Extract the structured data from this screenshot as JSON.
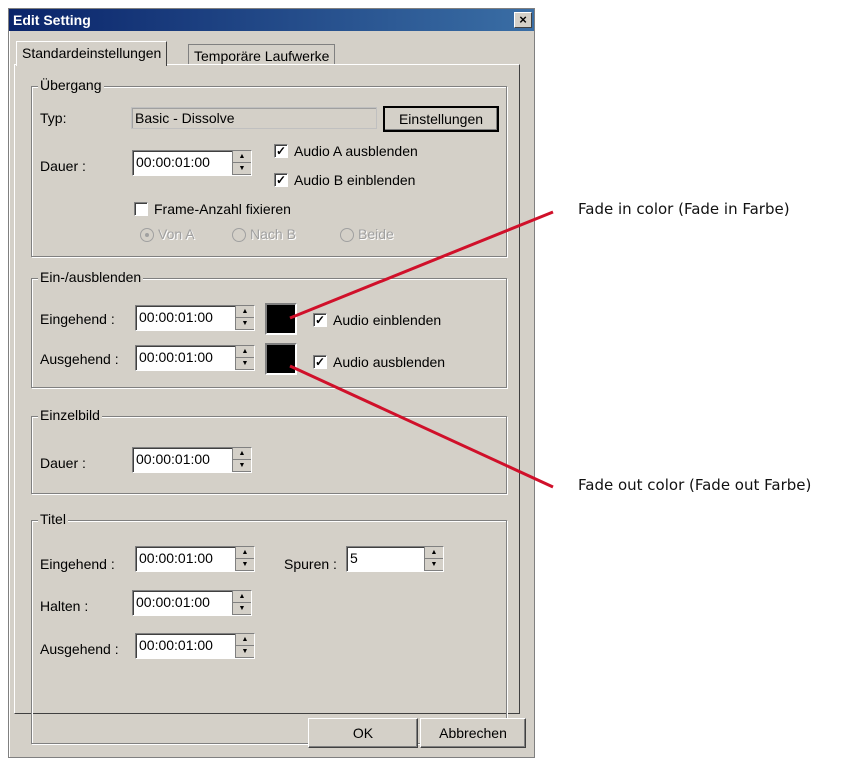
{
  "window": {
    "title": "Edit Setting",
    "close_glyph": "×"
  },
  "tabs": [
    {
      "label": "Standardeinstellungen",
      "active": true
    },
    {
      "label": "Temporäre Laufwerke",
      "active": false
    }
  ],
  "uebergang": {
    "group_label": "Übergang",
    "typ_label": "Typ:",
    "typ_value": "Basic - Dissolve",
    "einstellungen_button": "Einstellungen",
    "dauer_label": "Dauer :",
    "dauer_value": "00:00:01:00",
    "audio_a_label": "Audio A ausblenden",
    "audio_a_checked": true,
    "audio_b_label": "Audio B einblenden",
    "audio_b_checked": true,
    "frame_label": "Frame-Anzahl fixieren",
    "frame_checked": false,
    "radio_von_a": "Von A",
    "radio_nach_b": "Nach B",
    "radio_beide": "Beide"
  },
  "fade": {
    "group_label": "Ein-/ausblenden",
    "eingehend_label": "Eingehend :",
    "eingehend_value": "00:00:01:00",
    "ausgehend_label": "Ausgehend :",
    "ausgehend_value": "00:00:01:00",
    "audio_ein_label": "Audio einblenden",
    "audio_aus_label": "Audio ausblenden",
    "in_color": "#000000",
    "out_color": "#000000"
  },
  "einzelbild": {
    "group_label": "Einzelbild",
    "dauer_label": "Dauer :",
    "dauer_value": "00:00:01:00"
  },
  "titel": {
    "group_label": "Titel",
    "eingehend_label": "Eingehend :",
    "eingehend_value": "00:00:01:00",
    "halten_label": "Halten :",
    "halten_value": "00:00:01:00",
    "ausgehend_label": "Ausgehend :",
    "ausgehend_value": "00:00:01:00",
    "spuren_label": "Spuren :",
    "spuren_value": "5"
  },
  "buttons": {
    "ok": "OK",
    "cancel": "Abbrechen"
  },
  "annotations": {
    "fade_in": "Fade in color (Fade in Farbe)",
    "fade_out": "Fade out color (Fade out Farbe)",
    "line_color": "#d0102a"
  },
  "glyphs": {
    "check": "✓",
    "up": "▲",
    "down": "▼"
  }
}
